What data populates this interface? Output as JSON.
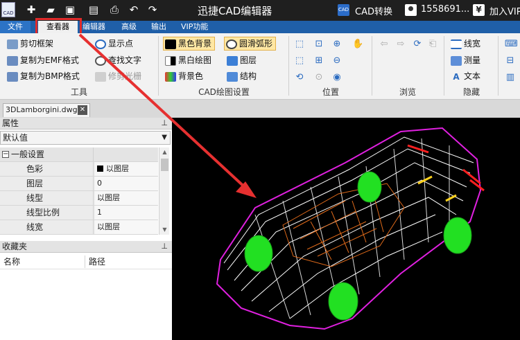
{
  "titlebar": {
    "logo_text": "CAD",
    "app_title": "迅捷CAD编辑器",
    "cad_icon_text": "CAD",
    "cad_convert": "CAD转换",
    "phone": "1558691...",
    "vip_icon_text": "¥",
    "vip_join": "加入VIP"
  },
  "menu": {
    "tabs": [
      "文件",
      "查看器",
      "编辑器",
      "高级",
      "输出",
      "VIP功能"
    ],
    "active": "查看器"
  },
  "ribbon": {
    "tools": {
      "label": "工具",
      "clip_frame": "剪切框架",
      "show_points": "显示点",
      "copy_emf": "复制为EMF格式",
      "find_text": "查找文字",
      "copy_bmp": "复制为BMP格式",
      "trim_raster": "修剪光栅"
    },
    "cad_settings": {
      "label": "CAD绘图设置",
      "black_bg": "黑色背景",
      "smooth_arc": "圆滑弧形",
      "bw_drawing": "黑白绘图",
      "layers": "图层",
      "bg_color": "背景色",
      "structure": "结构"
    },
    "position": {
      "label": "位置"
    },
    "browse": {
      "label": "浏览"
    },
    "hide": {
      "label": "隐藏",
      "linetype": "线宽",
      "measure": "测量",
      "text": "文本"
    }
  },
  "document": {
    "tab_name": "3DLamborgini.dwg",
    "close_glyph": "✕"
  },
  "properties": {
    "title": "属性",
    "pin": "ᵖ",
    "dropdown_value": "默认值",
    "group": "一般设置",
    "rows": [
      {
        "key": "色彩",
        "value": "以图层",
        "swatch": true
      },
      {
        "key": "图层",
        "value": "0"
      },
      {
        "key": "线型",
        "value": "以图层"
      },
      {
        "key": "线型比例",
        "value": "1"
      },
      {
        "key": "线宽",
        "value": "以图层"
      }
    ]
  },
  "favorites": {
    "title": "收藏夹",
    "col_name": "名称",
    "col_path": "路径"
  },
  "colors": {
    "titlebar_bg": "#1f1f1f",
    "menubar_bg": "#1f5fa8",
    "highlight": "#e02a2a",
    "canvas_bg": "#000000",
    "wheel_green": "#22e022",
    "body_white": "#ffffff",
    "interior_orange": "#e06a1a",
    "outline_magenta": "#e020e0"
  }
}
